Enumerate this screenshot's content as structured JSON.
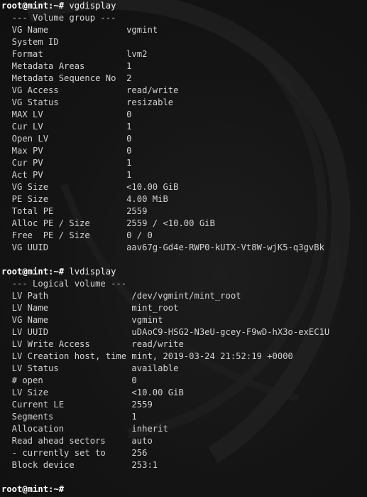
{
  "terminal": {
    "lines": [
      {
        "prompt": "root@mint:~#",
        "text": " vgdisplay"
      },
      {
        "text": "  --- Volume group ---"
      },
      {
        "text": "  VG Name               vgmint"
      },
      {
        "text": "  System ID"
      },
      {
        "text": "  Format                lvm2"
      },
      {
        "text": "  Metadata Areas        1"
      },
      {
        "text": "  Metadata Sequence No  2"
      },
      {
        "text": "  VG Access             read/write"
      },
      {
        "text": "  VG Status             resizable"
      },
      {
        "text": "  MAX LV                0"
      },
      {
        "text": "  Cur LV                1"
      },
      {
        "text": "  Open LV               0"
      },
      {
        "text": "  Max PV                0"
      },
      {
        "text": "  Cur PV                1"
      },
      {
        "text": "  Act PV                1"
      },
      {
        "text": "  VG Size               <10.00 GiB"
      },
      {
        "text": "  PE Size               4.00 MiB"
      },
      {
        "text": "  Total PE              2559"
      },
      {
        "text": "  Alloc PE / Size       2559 / <10.00 GiB"
      },
      {
        "text": "  Free  PE / Size       0 / 0"
      },
      {
        "text": "  VG UUID               aav67g-Gd4e-RWP0-kUTX-Vt8W-wjK5-q3gvBk"
      },
      {
        "text": ""
      },
      {
        "prompt": "root@mint:~#",
        "text": " lvdisplay"
      },
      {
        "text": "  --- Logical volume ---"
      },
      {
        "text": "  LV Path                /dev/vgmint/mint_root"
      },
      {
        "text": "  LV Name                mint_root"
      },
      {
        "text": "  VG Name                vgmint"
      },
      {
        "text": "  LV UUID                uDAoC9-HSG2-N3eU-gcey-F9wD-hX3o-exEC1U"
      },
      {
        "text": "  LV Write Access        read/write"
      },
      {
        "text": "  LV Creation host, time mint, 2019-03-24 21:52:19 +0000"
      },
      {
        "text": "  LV Status              available"
      },
      {
        "text": "  # open                 0"
      },
      {
        "text": "  LV Size                <10.00 GiB"
      },
      {
        "text": "  Current LE             2559"
      },
      {
        "text": "  Segments               1"
      },
      {
        "text": "  Allocation             inherit"
      },
      {
        "text": "  Read ahead sectors     auto"
      },
      {
        "text": "  - currently set to     256"
      },
      {
        "text": "  Block device           253:1"
      },
      {
        "text": ""
      },
      {
        "prompt": "root@mint:~#",
        "text": " "
      }
    ]
  }
}
